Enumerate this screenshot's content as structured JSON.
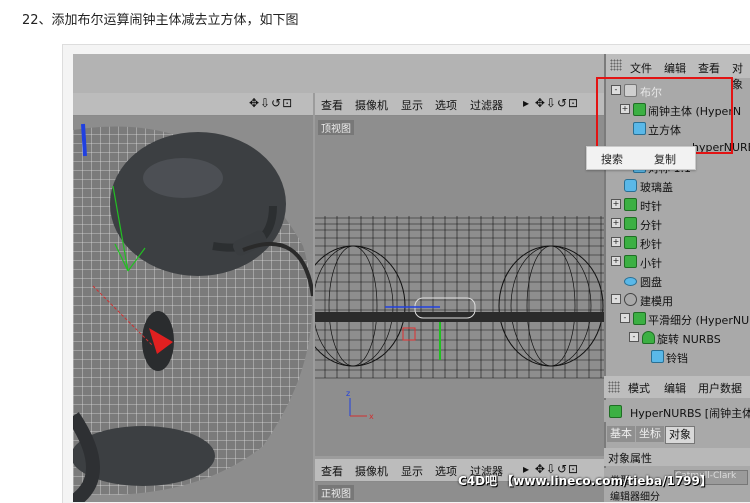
{
  "step_title": "22、添加布尔运算闹钟主体减去立方体，如下图",
  "viewport_left": {
    "nav_icons": "✥⇩↺⊡"
  },
  "viewport_right_top": {
    "menus": [
      "查看",
      "摄像机",
      "显示",
      "选项",
      "过滤器"
    ],
    "nav_icons": "▸ ✥⇩↺⊡",
    "view_label": "顶视图"
  },
  "viewport_right_bottom": {
    "menus": [
      "查看",
      "摄像机",
      "显示",
      "选项",
      "过滤器"
    ],
    "nav_icons": "▸ ✥⇩↺⊡",
    "view_label": "正视图"
  },
  "object_manager": {
    "menus": [
      "文件",
      "编辑",
      "查看",
      "对象"
    ],
    "items": [
      {
        "label": "布尔",
        "icon": "boolean-icon",
        "expander": "-"
      },
      {
        "label": "闹钟主体 (HyperN",
        "icon": "hypernurbs-icon",
        "expander": "+"
      },
      {
        "label": "立方体",
        "icon": "cube-icon",
        "expander": ""
      },
      {
        "label": "hyperNURBS",
        "icon": "",
        "expander": ""
      },
      {
        "label": "对称 1.1",
        "icon": "symmetry-icon",
        "expander": ""
      },
      {
        "label": "玻璃盖",
        "icon": "cylinder-icon",
        "expander": ""
      },
      {
        "label": "时针",
        "icon": "hypernurbs-icon",
        "expander": "+"
      },
      {
        "label": "分针",
        "icon": "hypernurbs-icon",
        "expander": "+"
      },
      {
        "label": "秒针",
        "icon": "hypernurbs-icon",
        "expander": "+"
      },
      {
        "label": "小针",
        "icon": "hypernurbs-icon",
        "expander": "+"
      },
      {
        "label": "圆盘",
        "icon": "disc-icon",
        "expander": ""
      },
      {
        "label": "建模用",
        "icon": "null-icon",
        "expander": "-"
      },
      {
        "label": "平滑细分 (HyperNU",
        "icon": "hypernurbs-icon",
        "expander": "-"
      },
      {
        "label": "旋转 NURBS",
        "icon": "lathe-icon",
        "expander": "-"
      },
      {
        "label": "铃铛",
        "icon": "spline-icon",
        "expander": ""
      }
    ]
  },
  "context_menu": {
    "search": "搜索",
    "copy": "复制"
  },
  "attributes": {
    "menus": [
      "模式",
      "编辑",
      "用户数据"
    ],
    "title": "HyperNURBS [闹钟主体",
    "tabs": [
      "基本",
      "坐标",
      "对象"
    ],
    "section": "对象属性",
    "type_label": "类型",
    "type_value": "Catmull-Clark",
    "subdiv_label": "编辑器细分"
  },
  "watermark": "C4D吧 【www.lineco.com/tieba/1799】"
}
